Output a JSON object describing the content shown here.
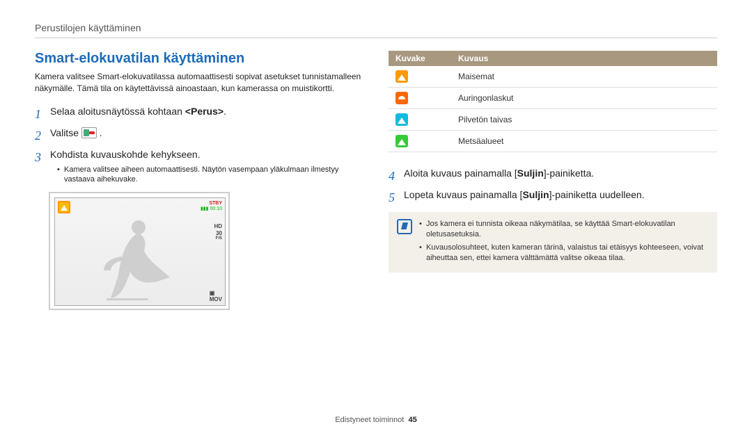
{
  "header": "Perustilojen käyttäminen",
  "title": "Smart-elokuvatilan käyttäminen",
  "intro": "Kamera valitsee Smart-elokuvatilassa automaattisesti sopivat asetukset tunnistamalleen näkymälle. Tämä tila on käytettävissä ainoastaan, kun kamerassa on muistikortti.",
  "steps": {
    "s1": {
      "num": "1",
      "pre": "Selaa aloitusnäytössä kohtaan ",
      "bold": "<Perus>",
      "post": "."
    },
    "s2": {
      "num": "2",
      "pre": "Valitse ",
      "post": " ."
    },
    "s3": {
      "num": "3",
      "text": "Kohdista kuvauskohde kehykseen.",
      "bullet": "Kamera valitsee aiheen automaattisesti. Näytön vasempaan yläkulmaan ilmestyy vastaava aihekuvake."
    },
    "s4": {
      "num": "4",
      "pre": "Aloita kuvaus painamalla [",
      "bold": "Suljin",
      "post": "]-painiketta."
    },
    "s5": {
      "num": "5",
      "pre": "Lopeta kuvaus painamalla [",
      "bold": "Suljin",
      "post": "]-painiketta uudelleen."
    }
  },
  "camera": {
    "stby": "STBY",
    "time": "00:10",
    "hd": "HD",
    "fps": "30",
    "unit": "F/S",
    "mov": "MOV"
  },
  "table": {
    "h1": "Kuvake",
    "h2": "Kuvaus",
    "rows": [
      {
        "label": "Maisemat",
        "icon": "landscape"
      },
      {
        "label": "Auringonlaskut",
        "icon": "sunset"
      },
      {
        "label": "Pilvetön taivas",
        "icon": "sky"
      },
      {
        "label": "Metsäalueet",
        "icon": "forest"
      }
    ]
  },
  "notes": [
    "Jos kamera ei tunnista oikeaa näkymätilaa, se käyttää Smart-elokuvatilan oletusasetuksia.",
    "Kuvausolosuhteet, kuten kameran tärinä, valaistus tai etäisyys kohteeseen, voivat aiheuttaa sen, ettei kamera välttämättä valitse oikeaa tilaa."
  ],
  "footer": {
    "section": "Edistyneet toiminnot",
    "page": "45"
  }
}
